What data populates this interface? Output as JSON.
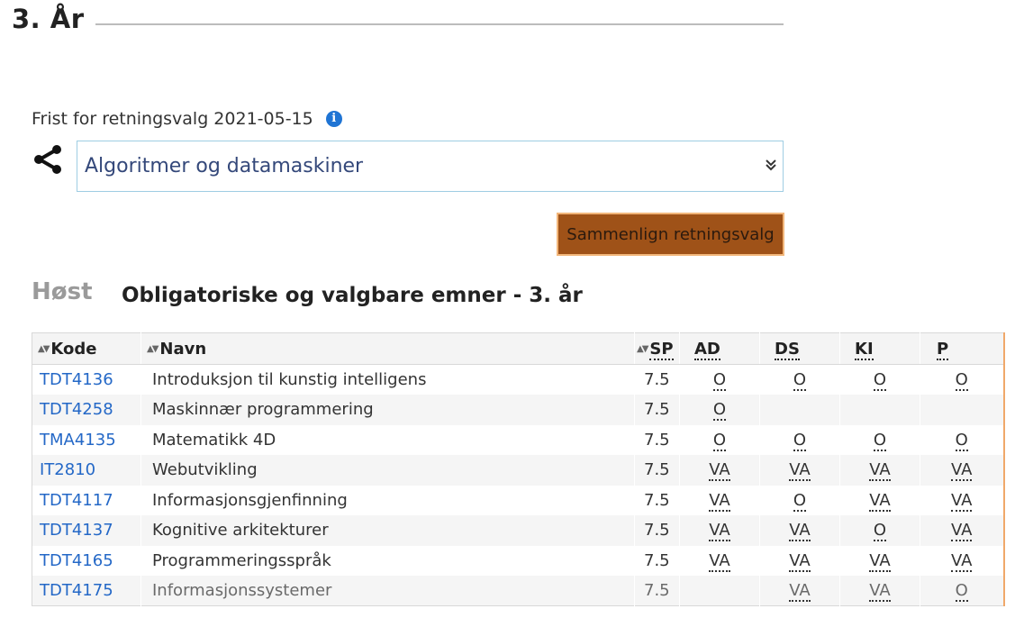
{
  "heading": {
    "year_title": "3. År"
  },
  "deadline": {
    "text": "Frist for retningsvalg 2021-05-15",
    "info_icon": "i"
  },
  "direction_select": {
    "selected": "Algoritmer og datamaskiner"
  },
  "compare_button": {
    "label": "Sammenlign retningsvalg"
  },
  "semester": {
    "label": "Høst"
  },
  "table": {
    "title": "Obligatoriske og valgbare emner - 3. år",
    "columns": {
      "code": "Kode",
      "name": "Navn",
      "sp": "SP",
      "ad": "AD",
      "ds": "DS",
      "ki": "KI",
      "p": "P"
    },
    "rows": [
      {
        "code": "TDT4136",
        "name": "Introduksjon til kunstig intelligens",
        "sp": "7.5",
        "ad": "O",
        "ds": "O",
        "ki": "O",
        "p": "O"
      },
      {
        "code": "TDT4258",
        "name": "Maskinnær programmering",
        "sp": "7.5",
        "ad": "O",
        "ds": "",
        "ki": "",
        "p": ""
      },
      {
        "code": "TMA4135",
        "name": "Matematikk 4D",
        "sp": "7.5",
        "ad": "O",
        "ds": "O",
        "ki": "O",
        "p": "O"
      },
      {
        "code": "IT2810",
        "name": "Webutvikling",
        "sp": "7.5",
        "ad": "VA",
        "ds": "VA",
        "ki": "VA",
        "p": "VA"
      },
      {
        "code": "TDT4117",
        "name": "Informasjonsgjenfinning",
        "sp": "7.5",
        "ad": "VA",
        "ds": "O",
        "ki": "VA",
        "p": "VA"
      },
      {
        "code": "TDT4137",
        "name": "Kognitive arkitekturer",
        "sp": "7.5",
        "ad": "VA",
        "ds": "VA",
        "ki": "O",
        "p": "VA"
      },
      {
        "code": "TDT4165",
        "name": "Programmeringsspråk",
        "sp": "7.5",
        "ad": "VA",
        "ds": "VA",
        "ki": "VA",
        "p": "VA"
      },
      {
        "code": "TDT4175",
        "name": "Informasjonssystemer",
        "sp": "7.5",
        "ad": "",
        "ds": "VA",
        "ki": "VA",
        "p": "O"
      }
    ]
  },
  "colors": {
    "link": "#2468c7",
    "button_bg": "#9f5218",
    "button_border": "#f2b67a",
    "select_border": "#9fcde3",
    "accent_border": "#f0a86a"
  },
  "icons": {
    "share": "share-nodes-icon",
    "info": "info-circle-icon",
    "select": "double-chevron-down-icon",
    "sort": "sort-arrows-icon"
  }
}
